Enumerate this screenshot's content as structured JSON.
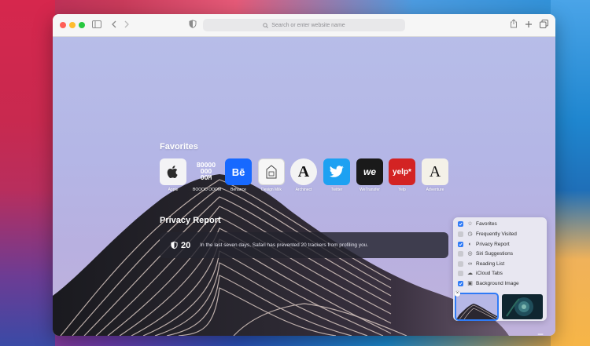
{
  "browser": {
    "address_placeholder": "Search or enter website name"
  },
  "colors": {
    "close": "#ff5f57",
    "minimize": "#febc2e",
    "zoom": "#28c840",
    "accent": "#2f7bf6"
  },
  "favorites": {
    "title": "Favorites",
    "items": [
      {
        "label": "Apple",
        "icon": "apple-logo-icon"
      },
      {
        "label": "BOOOO OOOM",
        "icon": "booooooom-logo-icon"
      },
      {
        "label": "Behance",
        "icon": "behance-logo-icon"
      },
      {
        "label": "Design Milk",
        "icon": "design-milk-logo-icon"
      },
      {
        "label": "Archinect",
        "icon": "archinect-logo-icon"
      },
      {
        "label": "Twitter",
        "icon": "twitter-logo-icon"
      },
      {
        "label": "WeTransfer",
        "icon": "wetransfer-logo-icon"
      },
      {
        "label": "Yelp",
        "icon": "yelp-logo-icon"
      },
      {
        "label": "Adventure",
        "icon": "adventure-logo-icon"
      }
    ]
  },
  "privacy": {
    "title": "Privacy Report",
    "count": "20",
    "message": "In the last seven days, Safari has prevented 20 trackers from profiling you."
  },
  "customize": {
    "options": [
      {
        "label": "Favorites",
        "checked": true,
        "icon": "star-icon"
      },
      {
        "label": "Frequently Visited",
        "checked": false,
        "icon": "clock-icon"
      },
      {
        "label": "Privacy Report",
        "checked": true,
        "icon": "shield-icon"
      },
      {
        "label": "Siri Suggestions",
        "checked": false,
        "icon": "siri-icon"
      },
      {
        "label": "Reading List",
        "checked": false,
        "icon": "glasses-icon"
      },
      {
        "label": "iCloud Tabs",
        "checked": false,
        "icon": "cloud-icon"
      },
      {
        "label": "Background Image",
        "checked": true,
        "icon": "photo-icon"
      }
    ]
  }
}
